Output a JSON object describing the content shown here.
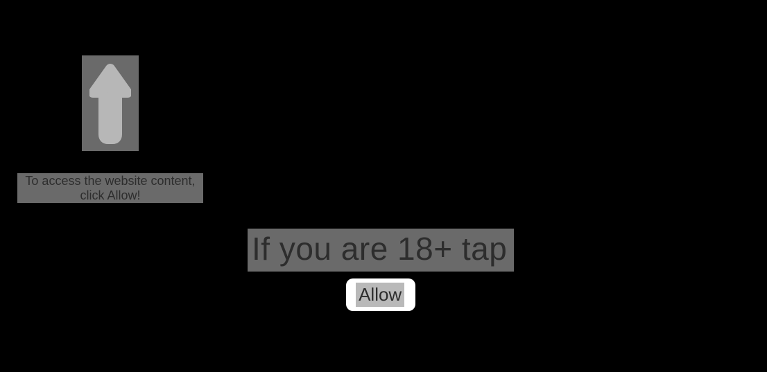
{
  "hint": {
    "line1": "To access the website content,",
    "line2": "click Allow!"
  },
  "main": {
    "heading": "If you are 18+ tap",
    "allow_label": "Allow"
  }
}
